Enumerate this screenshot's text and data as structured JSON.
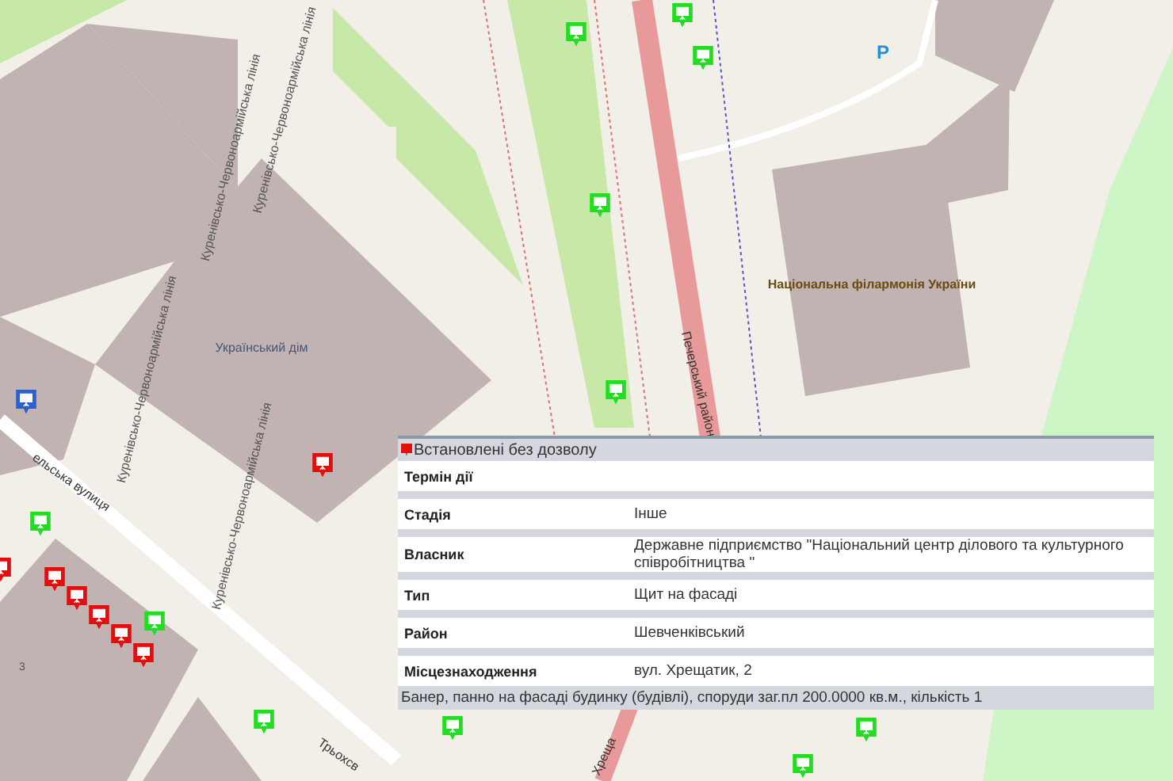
{
  "map": {
    "labels": [
      {
        "kind": "building",
        "text": "Український дім"
      },
      {
        "kind": "building",
        "text": "Національна філармонія України"
      },
      {
        "kind": "parking",
        "text": "P"
      },
      {
        "kind": "district",
        "text": "Печерський район"
      },
      {
        "kind": "line",
        "text": "Куренівсько-Червоноармійська лінія"
      },
      {
        "kind": "line",
        "text": "Куренівсько-Червоноармійська лінія"
      },
      {
        "kind": "line",
        "text": "Куренівсько-Червоноармійська лінія"
      },
      {
        "kind": "line",
        "text": "Куренівсько-Червоноармійська лінія"
      },
      {
        "kind": "street",
        "text": "ельська вулиця"
      },
      {
        "kind": "street",
        "text": "Трьохсв"
      },
      {
        "kind": "street",
        "text": "Хреща"
      },
      {
        "kind": "number",
        "text": "3"
      }
    ],
    "markers": [
      {
        "color": "#22dd22"
      },
      {
        "color": "#22dd22"
      },
      {
        "color": "#22dd22"
      },
      {
        "color": "#22dd22"
      },
      {
        "color": "#22dd22"
      },
      {
        "color": "#22dd22"
      },
      {
        "color": "#22dd22"
      },
      {
        "color": "#22dd22"
      },
      {
        "color": "#22dd22"
      },
      {
        "color": "#22dd22"
      },
      {
        "color": "#22dd22"
      },
      {
        "color": "#2a62c9"
      },
      {
        "color": "#e01010"
      },
      {
        "color": "#e01010"
      },
      {
        "color": "#e01010"
      },
      {
        "color": "#e01010"
      },
      {
        "color": "#e01010"
      },
      {
        "color": "#e01010"
      },
      {
        "color": "#e01010"
      }
    ]
  },
  "popup": {
    "title": "Встановлені без дозволу",
    "rows": [
      {
        "label": "Термін дії"
      },
      {
        "label": "Стадія",
        "value": "Інше"
      },
      {
        "label": "Власник",
        "value": "Державне підприємство \"Національний центр ділового та культурного співробітництва \""
      },
      {
        "label": "Тип",
        "value": "Щит на фасаді"
      },
      {
        "label": "Район",
        "value": "Шевченківський"
      },
      {
        "label": "Місцезнаходження",
        "value": "вул. Хрещатик, 2"
      }
    ],
    "description": "Банер, панно на фасаді будинку (будівлі), споруди заг.пл 200.0000 кв.м., кількість 1"
  }
}
